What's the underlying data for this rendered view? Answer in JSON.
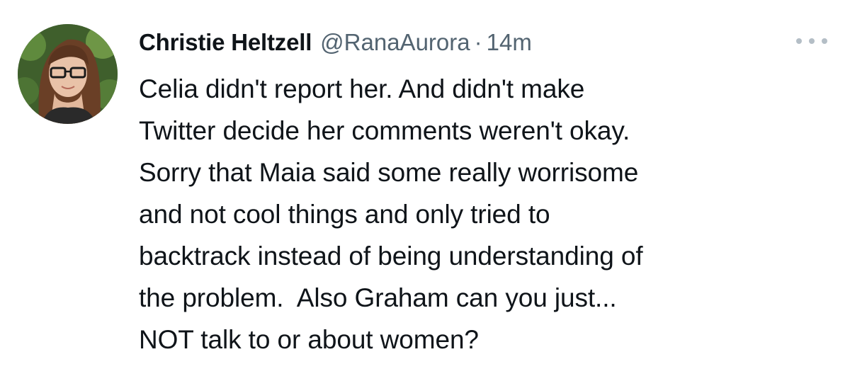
{
  "tweet": {
    "display_name": "Christie Heltzell",
    "handle": "@RanaAurora",
    "separator": "·",
    "timestamp": "14m",
    "more_icon": "more-horizontal-icon",
    "lines": [
      "Celia didn't report her. And didn't make",
      "Twitter decide her comments weren't okay.",
      "Sorry that Maia said some really worrisome",
      "and not cool things and only tried to",
      "backtrack instead of being understanding of",
      "the problem.  Also Graham can you just...",
      "NOT talk to or about women?"
    ]
  },
  "colors": {
    "text": "#0f1419",
    "secondary": "#536471",
    "more_dots": "#b4bec6",
    "background": "#ffffff"
  }
}
